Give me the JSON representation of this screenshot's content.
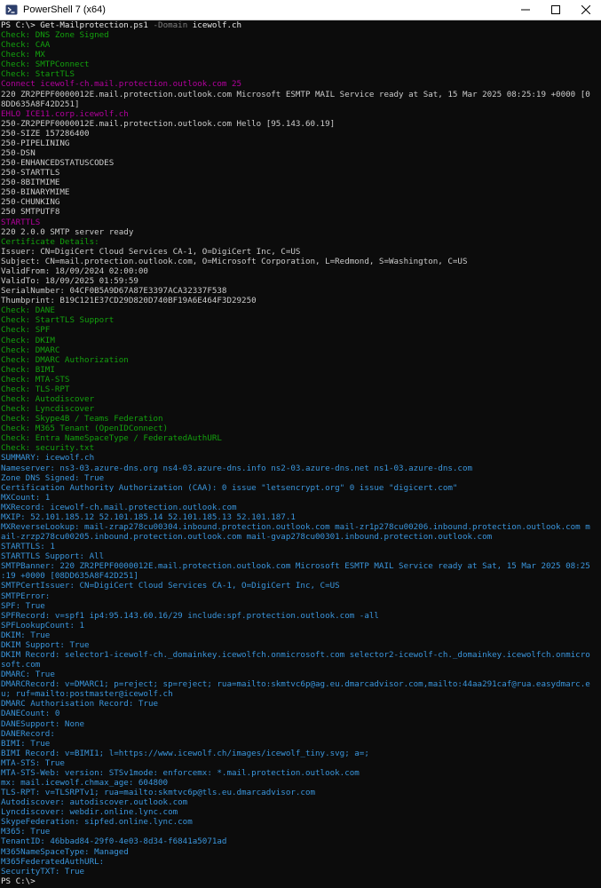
{
  "window": {
    "title": "PowerShell 7 (x64)"
  },
  "terminal": {
    "command": {
      "prompt": "PS C:\\> ",
      "name": "Get-Mailprotection.ps1",
      "param": " -Domain",
      "value": " icewolf.ch"
    },
    "lines": [
      {
        "t": "Check: DNS Zone Signed",
        "c": "check"
      },
      {
        "t": "Check: CAA",
        "c": "check"
      },
      {
        "t": "Check: MX",
        "c": "check"
      },
      {
        "t": "Check: SMTPConnect",
        "c": "check"
      },
      {
        "t": "Check: StartTLS",
        "c": "check"
      },
      {
        "t": "Connect icewolf-ch.mail.protection.outlook.com 25",
        "c": "magenta"
      },
      {
        "t": "220 ZR2PEPF0000012E.mail.protection.outlook.com Microsoft ESMTP MAIL Service ready at Sat, 15 Mar 2025 08:25:19 +0000 [0",
        "c": "default"
      },
      {
        "t": "8DD635A8F42D251]",
        "c": "default"
      },
      {
        "t": "EHLO ICE11.corp.icewolf.ch",
        "c": "magenta"
      },
      {
        "t": "250-ZR2PEPF0000012E.mail.protection.outlook.com Hello [95.143.60.19]",
        "c": "default"
      },
      {
        "t": "250-SIZE 157286400",
        "c": "default"
      },
      {
        "t": "250-PIPELINING",
        "c": "default"
      },
      {
        "t": "250-DSN",
        "c": "default"
      },
      {
        "t": "250-ENHANCEDSTATUSCODES",
        "c": "default"
      },
      {
        "t": "250-STARTTLS",
        "c": "default"
      },
      {
        "t": "250-8BITMIME",
        "c": "default"
      },
      {
        "t": "250-BINARYMIME",
        "c": "default"
      },
      {
        "t": "250-CHUNKING",
        "c": "default"
      },
      {
        "t": "250 SMTPUTF8",
        "c": "default"
      },
      {
        "t": "STARTTLS",
        "c": "magenta"
      },
      {
        "t": "220 2.0.0 SMTP server ready",
        "c": "default"
      },
      {
        "t": "Certificate Details:",
        "c": "check"
      },
      {
        "t": "Issuer: CN=DigiCert Cloud Services CA-1, O=DigiCert Inc, C=US",
        "c": "default"
      },
      {
        "t": "Subject: CN=mail.protection.outlook.com, O=Microsoft Corporation, L=Redmond, S=Washington, C=US",
        "c": "default"
      },
      {
        "t": "ValidFrom: 18/09/2024 02:00:00",
        "c": "default"
      },
      {
        "t": "ValidTo: 18/09/2025 01:59:59",
        "c": "default"
      },
      {
        "t": "SerialNumber: 04CF0B5A9D67A87E3397ACA32337F538",
        "c": "default"
      },
      {
        "t": "Thumbprint: B19C121E37CD29D820D740BF19A6E464F3D29250",
        "c": "default"
      },
      {
        "t": "Check: DANE",
        "c": "check"
      },
      {
        "t": "Check: StartTLS Support",
        "c": "check"
      },
      {
        "t": "Check: SPF",
        "c": "check"
      },
      {
        "t": "Check: DKIM",
        "c": "check"
      },
      {
        "t": "Check: DMARC",
        "c": "check"
      },
      {
        "t": "Check: DMARC Authorization",
        "c": "check"
      },
      {
        "t": "Check: BIMI",
        "c": "check"
      },
      {
        "t": "Check: MTA-STS",
        "c": "check"
      },
      {
        "t": "Check: TLS-RPT",
        "c": "check"
      },
      {
        "t": "Check: Autodiscover",
        "c": "check"
      },
      {
        "t": "Check: Lyncdiscover",
        "c": "check"
      },
      {
        "t": "Check: Skype4B / Teams Federation",
        "c": "check"
      },
      {
        "t": "Check: M365 Tenant (OpenIDConnect)",
        "c": "check"
      },
      {
        "t": "Check: Entra NameSpaceType / FederatedAuthURL",
        "c": "check"
      },
      {
        "t": "Check: security.txt",
        "c": "check"
      },
      {
        "t": "SUMMARY: icewolf.ch",
        "c": "cyan"
      },
      {
        "t": "Nameserver: ns3-03.azure-dns.org ns4-03.azure-dns.info ns2-03.azure-dns.net ns1-03.azure-dns.com",
        "c": "cyan"
      },
      {
        "t": "Zone DNS Signed: True",
        "c": "cyan"
      },
      {
        "t": "Certification Authority Authorization (CAA): 0 issue \"letsencrypt.org\" 0 issue \"digicert.com\"",
        "c": "cyan"
      },
      {
        "t": "MXCount: 1",
        "c": "cyan"
      },
      {
        "t": "MXRecord: icewolf-ch.mail.protection.outlook.com",
        "c": "cyan"
      },
      {
        "t": "MXIP: 52.101.185.12 52.101.185.14 52.101.185.13 52.101.187.1",
        "c": "cyan"
      },
      {
        "t": "MXReverseLookup: mail-zrap278cu00304.inbound.protection.outlook.com mail-zr1p278cu00206.inbound.protection.outlook.com m",
        "c": "cyan"
      },
      {
        "t": "ail-zrzp278cu00205.inbound.protection.outlook.com mail-gvap278cu00301.inbound.protection.outlook.com",
        "c": "cyan"
      },
      {
        "t": "STARTTLS: 1",
        "c": "cyan"
      },
      {
        "t": "STARTTLS Support: All",
        "c": "cyan"
      },
      {
        "t": "SMTPBanner: 220 ZR2PEPF0000012E.mail.protection.outlook.com Microsoft ESMTP MAIL Service ready at Sat, 15 Mar 2025 08:25",
        "c": "cyan"
      },
      {
        "t": ":19 +0000 [08DD635A8F42D251]",
        "c": "cyan"
      },
      {
        "t": "SMTPCertIssuer: CN=DigiCert Cloud Services CA-1, O=DigiCert Inc, C=US",
        "c": "cyan"
      },
      {
        "t": "SMTPError:",
        "c": "cyan"
      },
      {
        "t": "SPF: True",
        "c": "cyan"
      },
      {
        "t": "SPFRecord: v=spf1 ip4:95.143.60.16/29 include:spf.protection.outlook.com -all",
        "c": "cyan"
      },
      {
        "t": "SPFLookupCount: 1",
        "c": "cyan"
      },
      {
        "t": "DKIM: True",
        "c": "cyan"
      },
      {
        "t": "DKIM Support: True",
        "c": "cyan"
      },
      {
        "t": "DKIM Record: selector1-icewolf-ch._domainkey.icewolfch.onmicrosoft.com selector2-icewolf-ch._domainkey.icewolfch.onmicro",
        "c": "cyan"
      },
      {
        "t": "soft.com",
        "c": "cyan"
      },
      {
        "t": "DMARC: True",
        "c": "cyan"
      },
      {
        "t": "DMARCRecord: v=DMARC1; p=reject; sp=reject; rua=mailto:skmtvc6p@ag.eu.dmarcadvisor.com,mailto:44aa291caf@rua.easydmarc.e",
        "c": "cyan"
      },
      {
        "t": "u; ruf=mailto:postmaster@icewolf.ch",
        "c": "cyan"
      },
      {
        "t": "DMARC Authorisation Record: True",
        "c": "cyan"
      },
      {
        "t": "DANECount: 0",
        "c": "cyan"
      },
      {
        "t": "DANESupport: None",
        "c": "cyan"
      },
      {
        "t": "DANERecord:",
        "c": "cyan"
      },
      {
        "t": "BIMI: True",
        "c": "cyan"
      },
      {
        "t": "BIMI Record: v=BIMI1; l=https://www.icewolf.ch/images/icewolf_tiny.svg; a=;",
        "c": "cyan"
      },
      {
        "t": "MTA-STS: True",
        "c": "cyan"
      },
      {
        "t": "MTA-STS-Web: version: STSv1mode: enforcemx: *.mail.protection.outlook.com",
        "c": "cyan"
      },
      {
        "t": "mx: mail.icewolf.chmax_age: 604800",
        "c": "cyan"
      },
      {
        "t": "TLS-RPT: v=TLSRPTv1; rua=mailto:skmtvc6p@tls.eu.dmarcadvisor.com",
        "c": "cyan"
      },
      {
        "t": "Autodiscover: autodiscover.outlook.com",
        "c": "cyan"
      },
      {
        "t": "Lyncdiscover: webdir.online.lync.com",
        "c": "cyan"
      },
      {
        "t": "SkypeFederation: sipfed.online.lync.com",
        "c": "cyan"
      },
      {
        "t": "M365: True",
        "c": "cyan"
      },
      {
        "t": "TenantID: 46bbad84-29f0-4e03-8d34-f6841a5071ad",
        "c": "cyan"
      },
      {
        "t": "M365NameSpaceType: Managed",
        "c": "cyan"
      },
      {
        "t": "M365FederatedAuthURL:",
        "c": "cyan"
      },
      {
        "t": "SecurityTXT: True",
        "c": "cyan"
      }
    ],
    "final_prompt": "PS C:\\>"
  },
  "colors": {
    "background": "#0c0c0c",
    "default": "#cccccc",
    "check": "#13a10e",
    "magenta": "#b4009e",
    "cyan": "#3a96dd"
  },
  "icons": {
    "app": "powershell-icon",
    "minimize": "minimize-icon",
    "maximize": "maximize-icon",
    "close": "close-icon"
  }
}
